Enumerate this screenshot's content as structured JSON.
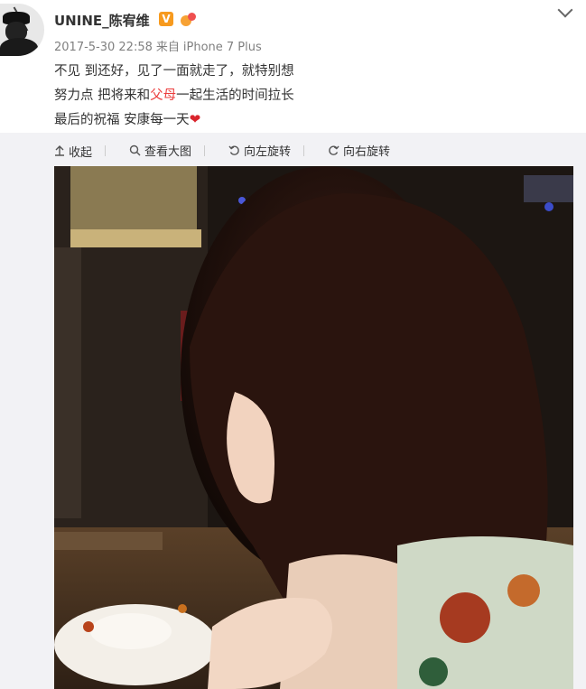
{
  "post": {
    "username": "UNINE_陈宥维",
    "verified_badge": "V",
    "timestamp": "2017-5-30 22:58",
    "source_prefix": "来自",
    "source_device": "iPhone 7 Plus",
    "content": {
      "line1": "不见 到还好，见了一面就走了，就特别想",
      "line2_before": "努力点 把将来和",
      "line2_highlight": "父母",
      "line2_after": "一起生活的时间拉长",
      "line3": "最后的祝福 安康每一天",
      "line3_emoji": "❤"
    }
  },
  "toolbar": {
    "collapse_label": "收起",
    "view_large_label": "查看大图",
    "rotate_left_label": "向左旋转",
    "rotate_right_label": "向右旋转"
  },
  "colors": {
    "highlight_red": "#eb3d3d",
    "verified_orange": "#f79a1e",
    "meta_gray": "#808080",
    "toolbar_bg": "#f2f2f5"
  },
  "icons": [
    "avatar",
    "verified-badge-icon",
    "medal-icon",
    "chevron-down-icon",
    "collapse-arrow-icon",
    "search-icon",
    "rotate-left-icon",
    "rotate-right-icon",
    "heart-icon"
  ]
}
